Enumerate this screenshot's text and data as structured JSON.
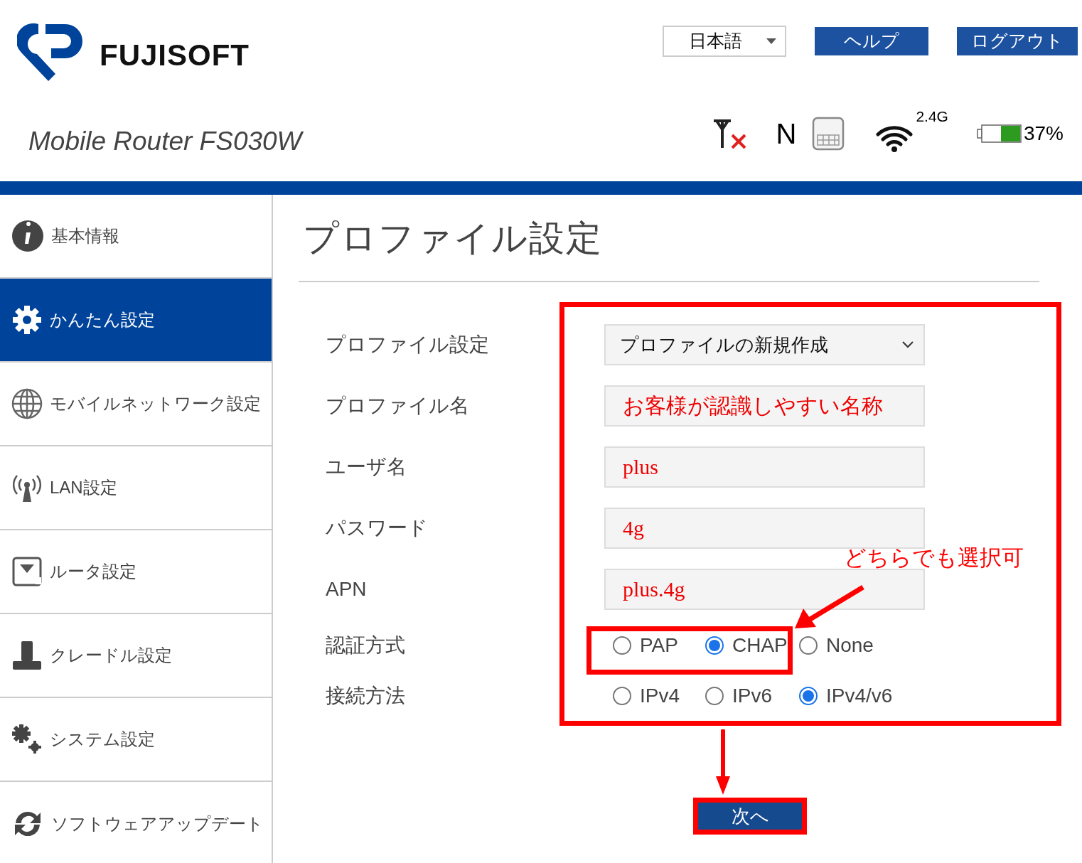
{
  "header": {
    "brand": "FUJISOFT",
    "model": "Mobile Router FS030W",
    "language": "日本語",
    "buttons": [
      "ヘルプ",
      "ログアウト"
    ]
  },
  "status": {
    "network": "N",
    "wifi_band": "2.4G",
    "battery": "37%"
  },
  "sidebar": {
    "items": [
      {
        "label": "基本情報",
        "selected": false
      },
      {
        "label": "かんたん設定",
        "selected": true
      },
      {
        "label": "モバイルネットワーク設定",
        "selected": false
      },
      {
        "label": "LAN設定",
        "selected": false
      },
      {
        "label": "ルータ設定",
        "selected": false
      },
      {
        "label": "クレードル設定",
        "selected": false
      },
      {
        "label": "システム設定",
        "selected": false
      },
      {
        "label": "ソフトウェアアップデート",
        "selected": false
      }
    ]
  },
  "page_title": "プロファイル設定",
  "form": [
    {
      "label": "プロファイル設定",
      "kind": "select",
      "value": "プロファイルの新規作成"
    },
    {
      "label": "プロファイル名",
      "kind": "text",
      "value": "お客様が認識しやすい名称"
    },
    {
      "label": "ユーザ名",
      "kind": "text",
      "value": "plus"
    },
    {
      "label": "パスワード",
      "kind": "text",
      "value": "4g"
    },
    {
      "label": "APN",
      "kind": "text",
      "value": "plus.4g"
    },
    {
      "label": "認証方式",
      "kind": "radio",
      "options": [
        {
          "label": "PAP",
          "selected": false
        },
        {
          "label": "CHAP",
          "selected": true
        },
        {
          "label": "None",
          "selected": false
        }
      ]
    },
    {
      "label": "接続方法",
      "kind": "radio",
      "options": [
        {
          "label": "IPv4",
          "selected": false
        },
        {
          "label": "IPv6",
          "selected": false
        },
        {
          "label": "IPv4/v6",
          "selected": true
        }
      ]
    }
  ],
  "annotation": "どちらでも選択可",
  "next_button": "次へ"
}
